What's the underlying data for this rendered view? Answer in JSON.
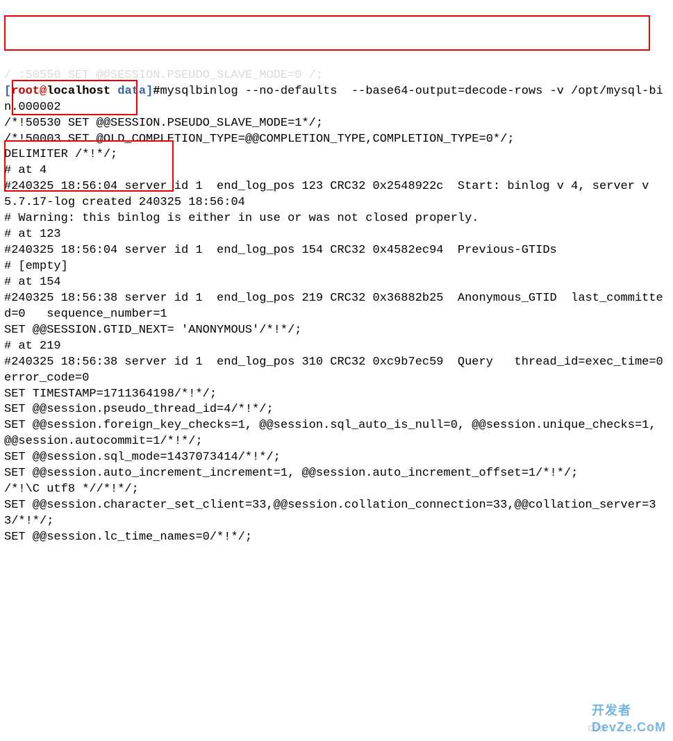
{
  "truncated_top": "/ :50550 SET @@SESSION.PSEUDO_SLAVE_MODE=0 /;",
  "prompt": {
    "open_bracket": "[",
    "user": "root",
    "at": "@",
    "host": "localhost ",
    "path": "data",
    "close_bracket": "]",
    "hash": "#"
  },
  "command": "mysqlbinlog --no-defaults  --base64-output=decode-rows -v /opt/mysql-bin.000002",
  "lines": {
    "l01": "/*!50530 SET @@SESSION.PSEUDO_SLAVE_MODE=1*/;",
    "l02": "/*!50003 SET @OLD_COMPLETION_TYPE=@@COMPLETION_TYPE,COMPLETION_TYPE=0*/;",
    "l03": "DELIMITER /*!*/;",
    "l04": "# at 4",
    "l05": "#240325 18:56:04 server id 1  end_log_pos 123 CRC32 0x2548922c  Start: binlog v 4, server v 5.7.17-log created 240325 18:56:04",
    "l06": "# Warning: this binlog is either in use or was not closed properly.",
    "l07": "# at 123",
    "l08": "#240325 18:56:04 server id 1  end_log_pos 154 CRC32 0x4582ec94  Previous-GTIDs",
    "l09": "# [empty]",
    "l10": "# at 154",
    "l11": "#240325 18:56:38 server id 1  end_log_pos 219 CRC32 0x36882b25  Anonymous_GTID  last_committed=0   sequence_number=1",
    "l12": "SET @@SESSION.GTID_NEXT= 'ANONYMOUS'/*!*/;",
    "l13": "# at 219",
    "l14": "#240325 18:56:38 server id 1  end_log_pos 310 CRC32 0xc9b7ec59  Query   thread_id=exec_time=0     error_code=0",
    "l15": "SET TIMESTAMP=1711364198/*!*/;",
    "l16": "SET @@session.pseudo_thread_id=4/*!*/;",
    "l17": "SET @@session.foreign_key_checks=1, @@session.sql_auto_is_null=0, @@session.unique_checks=1, @@session.autocommit=1/*!*/;",
    "l18": "SET @@session.sql_mode=1437073414/*!*/;",
    "l19": "SET @@session.auto_increment_increment=1, @@session.auto_increment_offset=1/*!*/;",
    "l20": "/*!\\C utf8 *//*!*/;",
    "l21": "SET @@session.character_set_client=33,@@session.collation_connection=33,@@collation_server=33/*!*/;",
    "l22": "SET @@session.lc_time_names=0/*!*/;"
  },
  "watermark_main": "开发者\nDevZe.CoM",
  "watermark_small": "CSD"
}
